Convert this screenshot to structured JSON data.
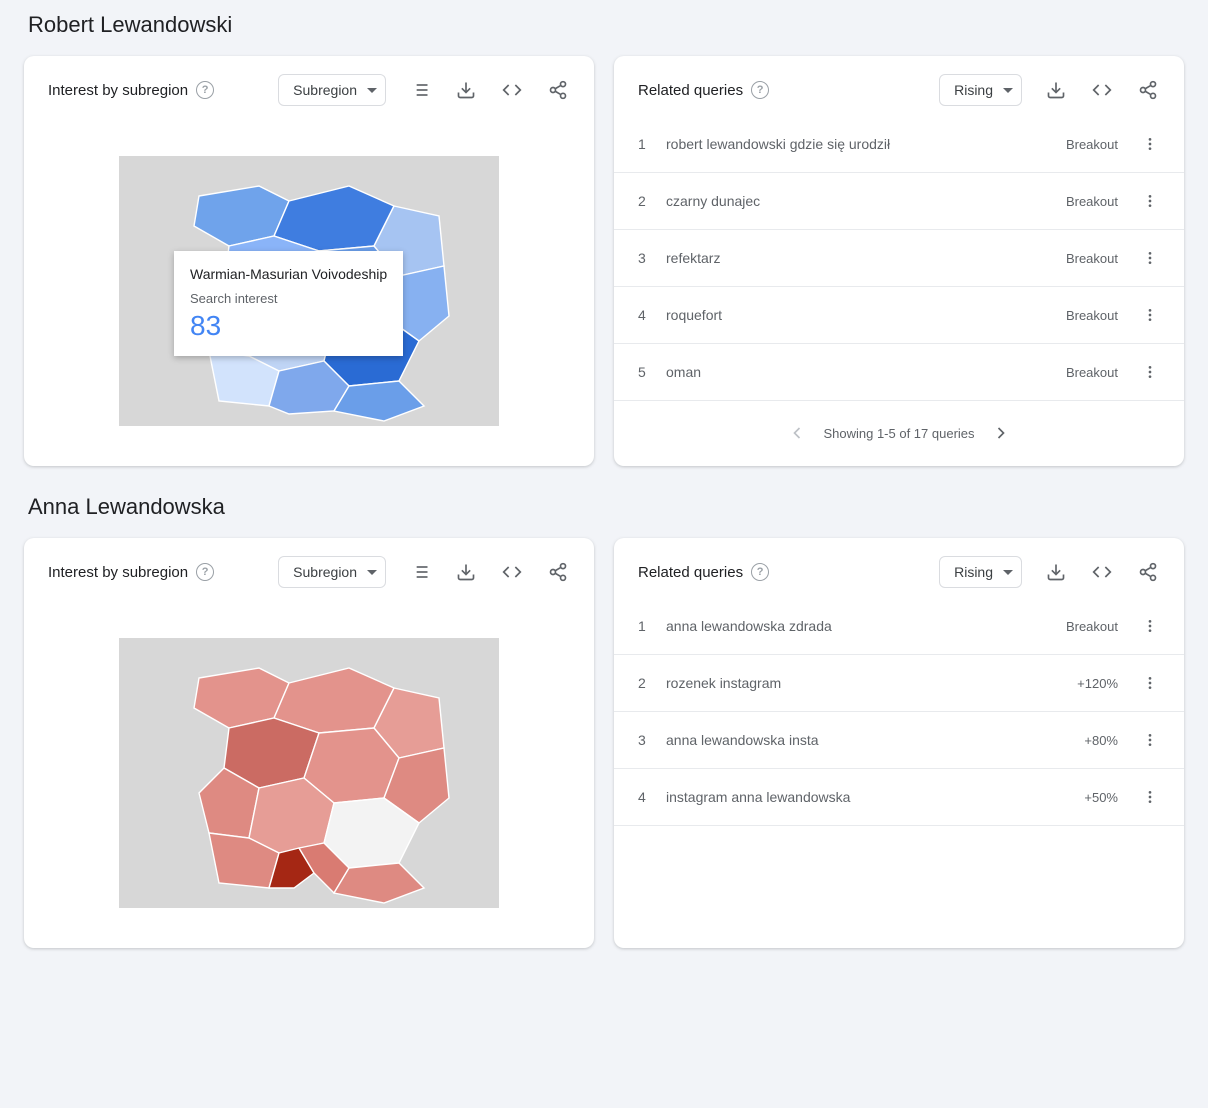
{
  "sections": [
    {
      "title": "Robert Lewandowski",
      "map": {
        "title": "Interest by subregion",
        "dropdown": "Subregion",
        "theme": "blue",
        "tooltip": {
          "region": "Warmian-Masurian Voivodeship",
          "label": "Search interest",
          "value": "83"
        }
      },
      "queries": {
        "title": "Related queries",
        "dropdown": "Rising",
        "rows": [
          {
            "rank": "1",
            "query": "robert lewandowski gdzie się urodził",
            "value": "Breakout"
          },
          {
            "rank": "2",
            "query": "czarny dunajec",
            "value": "Breakout"
          },
          {
            "rank": "3",
            "query": "refektarz",
            "value": "Breakout"
          },
          {
            "rank": "4",
            "query": "roquefort",
            "value": "Breakout"
          },
          {
            "rank": "5",
            "query": "oman",
            "value": "Breakout"
          }
        ],
        "pager": "Showing 1-5 of 17 queries"
      }
    },
    {
      "title": "Anna Lewandowska",
      "map": {
        "title": "Interest by subregion",
        "dropdown": "Subregion",
        "theme": "red",
        "tooltip": null
      },
      "queries": {
        "title": "Related queries",
        "dropdown": "Rising",
        "rows": [
          {
            "rank": "1",
            "query": "anna lewandowska zdrada",
            "value": "Breakout"
          },
          {
            "rank": "2",
            "query": "rozenek instagram",
            "value": "+120%"
          },
          {
            "rank": "3",
            "query": "anna lewandowska insta",
            "value": "+80%"
          },
          {
            "rank": "4",
            "query": "instagram anna lewandowska",
            "value": "+50%"
          }
        ],
        "pager": null
      }
    }
  ],
  "chart_data": [
    {
      "type": "map",
      "title": "Robert Lewandowski — Interest by subregion (Poland)",
      "shown_region": "Warmian-Masurian Voivodeship",
      "shown_value": 83,
      "scale": [
        0,
        100
      ],
      "color_scheme": "blue"
    },
    {
      "type": "map",
      "title": "Anna Lewandowska — Interest by subregion (Poland)",
      "scale": [
        0,
        100
      ],
      "color_scheme": "red"
    }
  ]
}
